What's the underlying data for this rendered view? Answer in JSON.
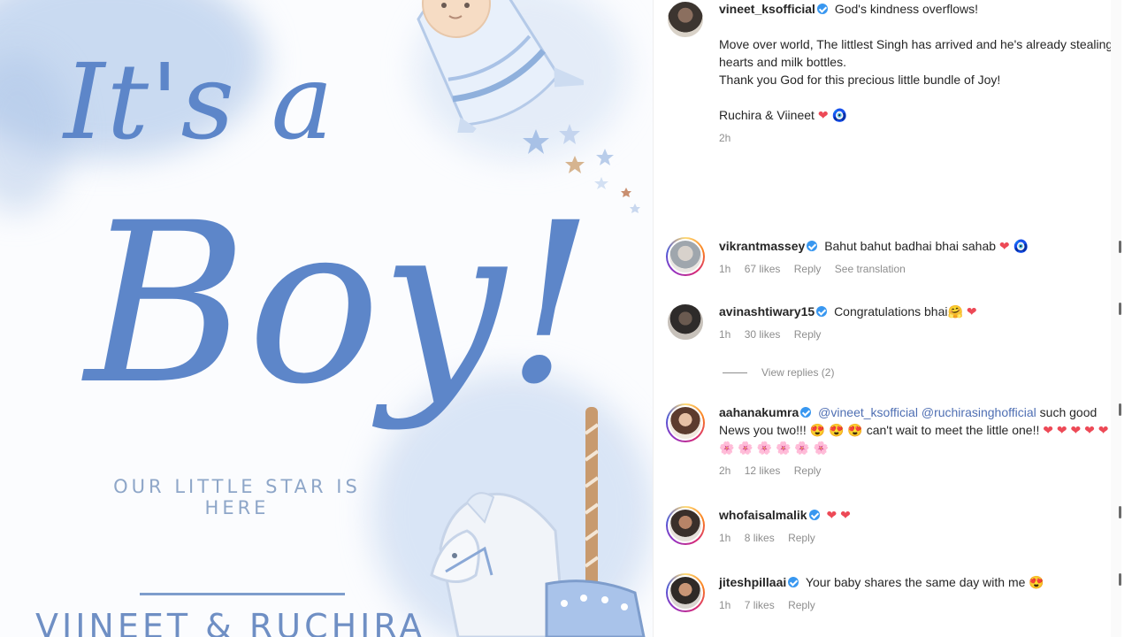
{
  "image": {
    "headline_top": "It's a",
    "headline_main": "Boy!",
    "tagline": "OUR LITTLE STAR IS HERE",
    "names": "VIINEET & RUCHIRA",
    "colors": {
      "script_blue": "#5d86c9",
      "tagline_gray": "#8ea6c8",
      "wash_blue": "#b9cdea"
    }
  },
  "caption": {
    "username": "vineet_ksofficial",
    "verified": true,
    "lines": [
      "God's kindness overflows!",
      "Move over world, The littlest Singh has arrived and he's already stealing hearts and milk bottles.",
      "Thank you God for this precious little bundle of Joy!",
      "Ruchira & Viineet"
    ],
    "sign_emojis": [
      "❤",
      "🧿"
    ],
    "time": "2h"
  },
  "comments": [
    {
      "username": "vikrantmassey",
      "text": "Bahut bahut badhai bhai sahab",
      "emojis": [
        "❤",
        "🧿"
      ],
      "time": "1h",
      "likes": "67 likes",
      "reply": "Reply",
      "translation": "See translation"
    },
    {
      "username": "avinashtiwary15",
      "text": "Congratulations bhai",
      "emojis": [
        "🤗",
        "❤"
      ],
      "time": "1h",
      "likes": "30 likes",
      "reply": "Reply",
      "view_replies": "View replies (2)"
    },
    {
      "username": "aahanakumra",
      "mention1": "@vineet_ksofficial",
      "mention2": "@ruchirasinghofficial",
      "text1": "such good News you two!!!",
      "emojis1": [
        "😍",
        "😍",
        "😍"
      ],
      "text2": "can't wait to meet the little one!!",
      "emojis2": [
        "❤",
        "❤",
        "❤",
        "❤",
        "❤",
        "🌸",
        "🌸",
        "🌸",
        "🌸",
        "🌸",
        "🌸"
      ],
      "time": "2h",
      "likes": "12 likes",
      "reply": "Reply"
    },
    {
      "username": "whofaisalmalik",
      "emojis": [
        "❤",
        "❤"
      ],
      "time": "1h",
      "likes": "8 likes",
      "reply": "Reply"
    },
    {
      "username": "jiteshpillaai",
      "text": "Your baby shares the same day with me",
      "emojis": [
        "😍"
      ],
      "time": "1h",
      "likes": "7 likes",
      "reply": "Reply"
    }
  ]
}
